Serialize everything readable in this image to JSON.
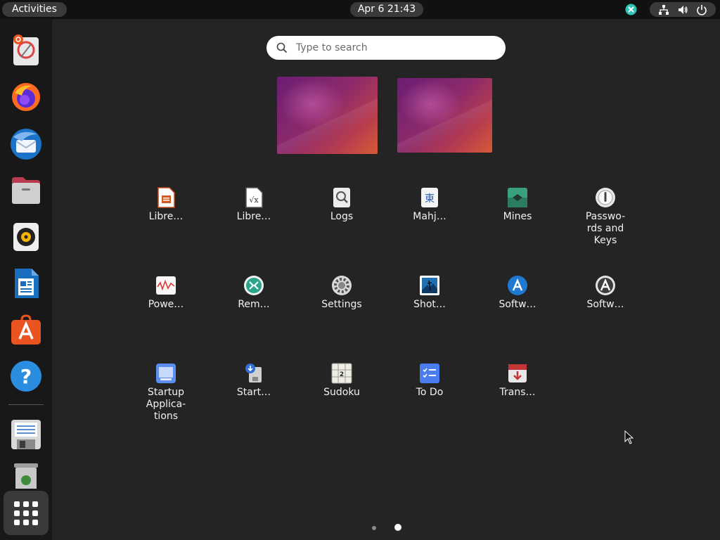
{
  "topbar": {
    "activities_label": "Activities",
    "clock": "Apr 6  21:43",
    "tray_icons": [
      "network-icon",
      "volume-icon",
      "power-icon"
    ]
  },
  "dock": {
    "items": [
      {
        "name": "ubuntu-help-icon",
        "tooltip": ""
      },
      {
        "name": "firefox-icon"
      },
      {
        "name": "thunderbird-icon"
      },
      {
        "name": "files-icon"
      },
      {
        "name": "rhythmbox-icon"
      },
      {
        "name": "writer-icon"
      },
      {
        "name": "app-center-icon"
      },
      {
        "name": "help-icon"
      },
      {
        "name": "text-file-icon"
      },
      {
        "name": "trash-icon"
      }
    ]
  },
  "search": {
    "placeholder": "Type to search"
  },
  "apps": {
    "row1": [
      "Libre…",
      "Libre…",
      "Logs",
      "Mahj…",
      "Mines",
      "Passwo-\nrds and\nKeys"
    ],
    "row2": [
      "Powe…",
      "Rem…",
      "Settings",
      "Shot…",
      "Softw…",
      "Softw…"
    ],
    "row3": [
      "Startup\nApplica-\ntions",
      "Start…",
      "Sudoku",
      "To Do",
      "Trans…"
    ]
  },
  "pagination": {
    "current_page": 2,
    "total_pages": 2
  },
  "colors": {
    "accent": "#e95420",
    "panel": "#111111",
    "background": "#242424"
  }
}
